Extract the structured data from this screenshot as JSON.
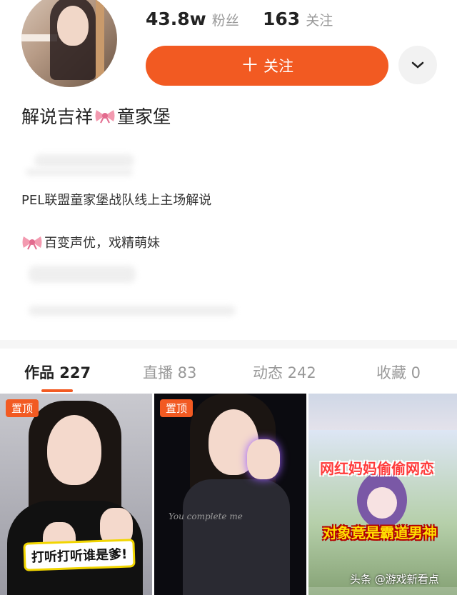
{
  "profile": {
    "fans_count": "43.8w",
    "fans_label": "粉丝",
    "following_count": "163",
    "following_label": "关注",
    "follow_button": "关注",
    "name_part1": "解说吉祥",
    "name_part2": "童家堡",
    "bio_line1": "PEL联盟童家堡战队线上主场解说",
    "bio_line2": "百变声优，戏精萌妹"
  },
  "tabs": [
    {
      "label": "作品 227",
      "active": true
    },
    {
      "label": "直播 83",
      "active": false
    },
    {
      "label": "动态 242",
      "active": false
    },
    {
      "label": "收藏 0",
      "active": false
    }
  ],
  "videos": [
    {
      "pinned_label": "置顶",
      "caption": "打听打听谁是爹!"
    },
    {
      "pinned_label": "置顶",
      "caption": "You complete me"
    },
    {
      "caption_top": "网红妈妈偷偷网恋",
      "caption_bottom": "对象竟是霸道男神"
    }
  ],
  "watermark": "头条 @游戏新看点",
  "colors": {
    "accent": "#f25a22",
    "muted": "#999999"
  },
  "icons": {
    "more": "chevron-down-icon",
    "plus": "plus-icon",
    "bow": "bow-emoji-icon"
  }
}
